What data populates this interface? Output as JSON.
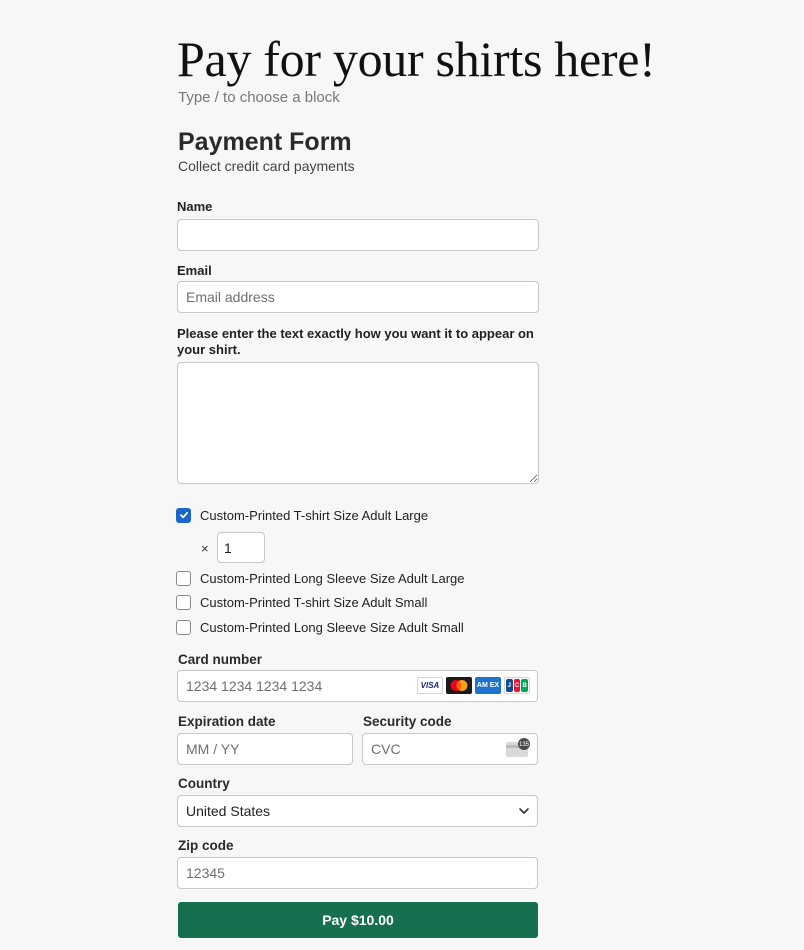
{
  "page": {
    "title": "Pay for your shirts here!",
    "block_hint": "Type / to choose a block"
  },
  "form": {
    "title": "Payment Form",
    "description": "Collect credit card payments",
    "name": {
      "label": "Name",
      "value": "",
      "placeholder": ""
    },
    "email": {
      "label": "Email",
      "value": "",
      "placeholder": "Email address"
    },
    "shirt_text": {
      "label": "Please enter the text exactly how you want it to appear on your shirt.",
      "value": ""
    },
    "products": [
      {
        "label": "Custom-Printed T-shirt Size Adult Large",
        "checked": true
      },
      {
        "label": "Custom-Printed Long Sleeve Size Adult Large",
        "checked": false
      },
      {
        "label": "Custom-Printed T-shirt Size Adult Small",
        "checked": false
      },
      {
        "label": "Custom-Printed Long Sleeve Size Adult Small",
        "checked": false
      }
    ],
    "quantity": {
      "prefix": "×",
      "value": "1"
    },
    "card_number": {
      "label": "Card number",
      "placeholder": "1234 1234 1234 1234"
    },
    "card_brands": [
      "visa-icon",
      "mastercard-icon",
      "amex-icon",
      "jcb-icon"
    ],
    "expiration": {
      "label": "Expiration date",
      "placeholder": "MM / YY"
    },
    "security_code": {
      "label": "Security code",
      "placeholder": "CVC",
      "icon_text": "135"
    },
    "country": {
      "label": "Country",
      "value": "United States"
    },
    "zip": {
      "label": "Zip code",
      "placeholder": "12345"
    },
    "pay_button": "Pay $10.00",
    "colors": {
      "accent_checkbox": "#1a66c9",
      "pay_button": "#16704f",
      "background": "#f7f7f7"
    }
  }
}
